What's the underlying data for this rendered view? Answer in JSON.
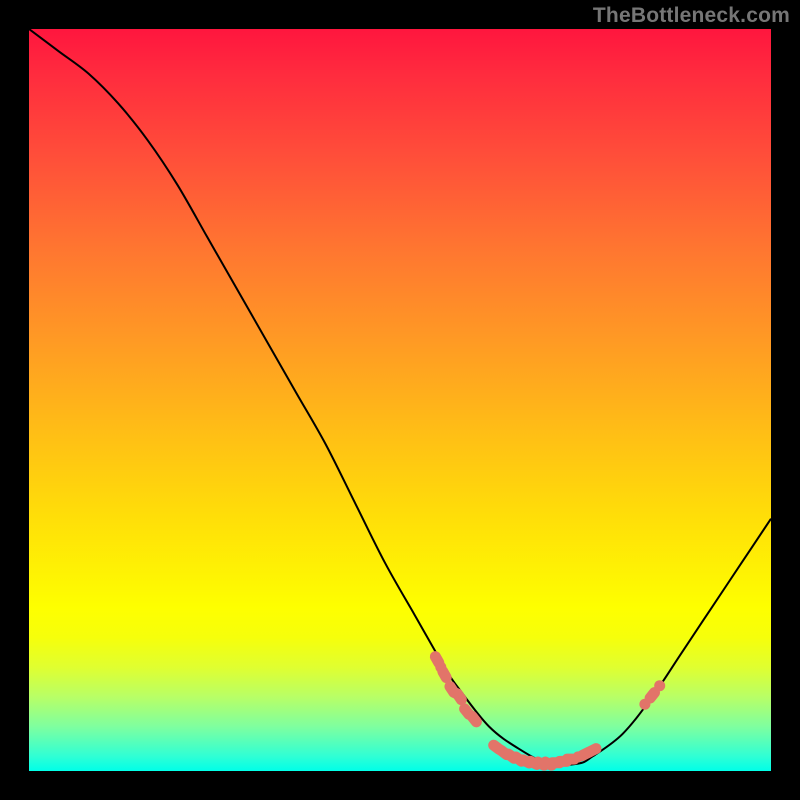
{
  "attribution": "TheBottleneck.com",
  "chart_data": {
    "type": "line",
    "title": "",
    "xlabel": "",
    "ylabel": "",
    "xlim": [
      0,
      100
    ],
    "ylim": [
      0,
      100
    ],
    "series": [
      {
        "name": "curve",
        "x": [
          0,
          4,
          8,
          12,
          16,
          20,
          24,
          28,
          32,
          36,
          40,
          44,
          48,
          52,
          56,
          58,
          62,
          66,
          70,
          74,
          76,
          80,
          84,
          88,
          92,
          96,
          100
        ],
        "y": [
          100,
          97,
          94,
          90,
          85,
          79,
          72,
          65,
          58,
          51,
          44,
          36,
          28,
          21,
          14,
          11,
          6,
          3,
          1,
          1,
          2,
          5,
          10,
          16,
          22,
          28,
          34
        ]
      }
    ],
    "markers": [
      {
        "name": "left-cluster",
        "style": "dash",
        "points": [
          {
            "x": 55,
            "y": 15
          },
          {
            "x": 56,
            "y": 13
          },
          {
            "x": 57,
            "y": 11
          },
          {
            "x": 58,
            "y": 10
          },
          {
            "x": 59,
            "y": 8
          },
          {
            "x": 60,
            "y": 7
          }
        ]
      },
      {
        "name": "left-dots",
        "style": "dot",
        "points": [
          {
            "x": 55.5,
            "y": 14
          },
          {
            "x": 57.5,
            "y": 10.5
          }
        ]
      },
      {
        "name": "valley-floor",
        "style": "dash",
        "points": [
          {
            "x": 63,
            "y": 3.2
          },
          {
            "x": 64,
            "y": 2.5
          },
          {
            "x": 65,
            "y": 2.0
          },
          {
            "x": 66,
            "y": 1.6
          },
          {
            "x": 67,
            "y": 1.3
          },
          {
            "x": 68,
            "y": 1.1
          },
          {
            "x": 69,
            "y": 1.0
          },
          {
            "x": 70,
            "y": 1.0
          },
          {
            "x": 71,
            "y": 1.1
          },
          {
            "x": 72,
            "y": 1.3
          },
          {
            "x": 73,
            "y": 1.6
          },
          {
            "x": 75,
            "y": 2.3
          },
          {
            "x": 76,
            "y": 2.8
          }
        ]
      },
      {
        "name": "valley-dots",
        "style": "dot",
        "points": [
          {
            "x": 74,
            "y": 1.9
          }
        ]
      },
      {
        "name": "right-dots",
        "style": "dot",
        "points": [
          {
            "x": 83,
            "y": 9
          },
          {
            "x": 85,
            "y": 11.5
          }
        ]
      },
      {
        "name": "right-dash",
        "style": "dash",
        "points": [
          {
            "x": 84,
            "y": 10.2
          }
        ]
      }
    ],
    "gradient_stops": [
      {
        "pos": 0,
        "color": "#ff163e"
      },
      {
        "pos": 18,
        "color": "#ff5139"
      },
      {
        "pos": 42,
        "color": "#ff9a24"
      },
      {
        "pos": 66,
        "color": "#ffdf08"
      },
      {
        "pos": 78,
        "color": "#feff00"
      },
      {
        "pos": 90,
        "color": "#b8ff66"
      },
      {
        "pos": 100,
        "color": "#00ffe8"
      }
    ]
  }
}
